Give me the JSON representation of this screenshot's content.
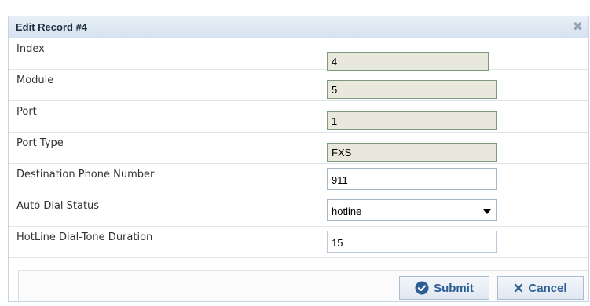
{
  "dialog": {
    "title": "Edit Record #4",
    "close_glyph": "✖"
  },
  "fields": [
    {
      "label": "Index",
      "value": "4",
      "kind": "readonly"
    },
    {
      "label": "Module",
      "value": "5",
      "kind": "readonly"
    },
    {
      "label": "Port",
      "value": "1",
      "kind": "readonly"
    },
    {
      "label": "Port Type",
      "value": "FXS",
      "kind": "readonly"
    },
    {
      "label": "Destination Phone Number",
      "value": "911",
      "kind": "text"
    },
    {
      "label": "Auto Dial Status",
      "value": "hotline",
      "kind": "select"
    },
    {
      "label": "HotLine Dial-Tone Duration",
      "value": "15",
      "kind": "text"
    }
  ],
  "buttons": {
    "submit": {
      "label": "Submit",
      "icon": "check-circle-icon"
    },
    "cancel": {
      "label": "Cancel",
      "icon": "x-icon"
    }
  },
  "colors": {
    "accent": "#2c5d93",
    "readonly_bg": "#e9e8dd",
    "readonly_border": "#7c9a7c"
  }
}
